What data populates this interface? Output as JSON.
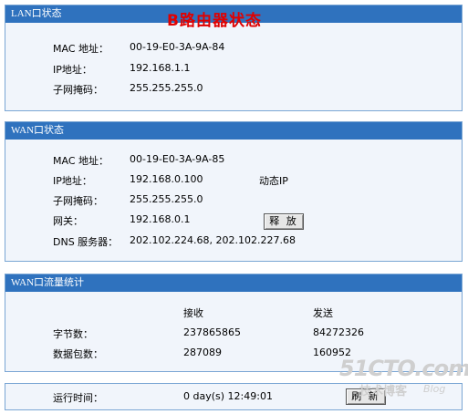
{
  "annotation": "B路由器状态",
  "lan": {
    "title": "LAN口状态",
    "mac_label": "MAC 地址：",
    "mac_value": "00-19-E0-3A-9A-84",
    "ip_label": "IP地址：",
    "ip_value": "192.168.1.1",
    "mask_label": "子网掩码：",
    "mask_value": "255.255.255.0"
  },
  "wan": {
    "title": "WAN口状态",
    "mac_label": "MAC 地址：",
    "mac_value": "00-19-E0-3A-9A-85",
    "ip_label": "IP地址：",
    "ip_value": "192.168.0.100",
    "ip_mode": "动态IP",
    "mask_label": "子网掩码：",
    "mask_value": "255.255.255.0",
    "gateway_label": "网关：",
    "gateway_value": "192.168.0.1",
    "release_label": "释 放",
    "dns_label": "DNS 服务器：",
    "dns_value": "202.102.224.68, 202.102.227.68"
  },
  "traffic": {
    "title": "WAN口流量统计",
    "col_receive": "接收",
    "col_send": "发送",
    "rows": [
      {
        "label": "字节数：",
        "receive": "237865865",
        "send": "84272326"
      },
      {
        "label": "数据包数：",
        "receive": "287089",
        "send": "160952"
      }
    ]
  },
  "runtime": {
    "label": "运行时间：",
    "value": "0 day(s) 12:49:01",
    "refresh_label": "刷 新"
  },
  "watermark": {
    "main": "51CTO.com",
    "sub": "技术博客",
    "blog": "Blog"
  }
}
